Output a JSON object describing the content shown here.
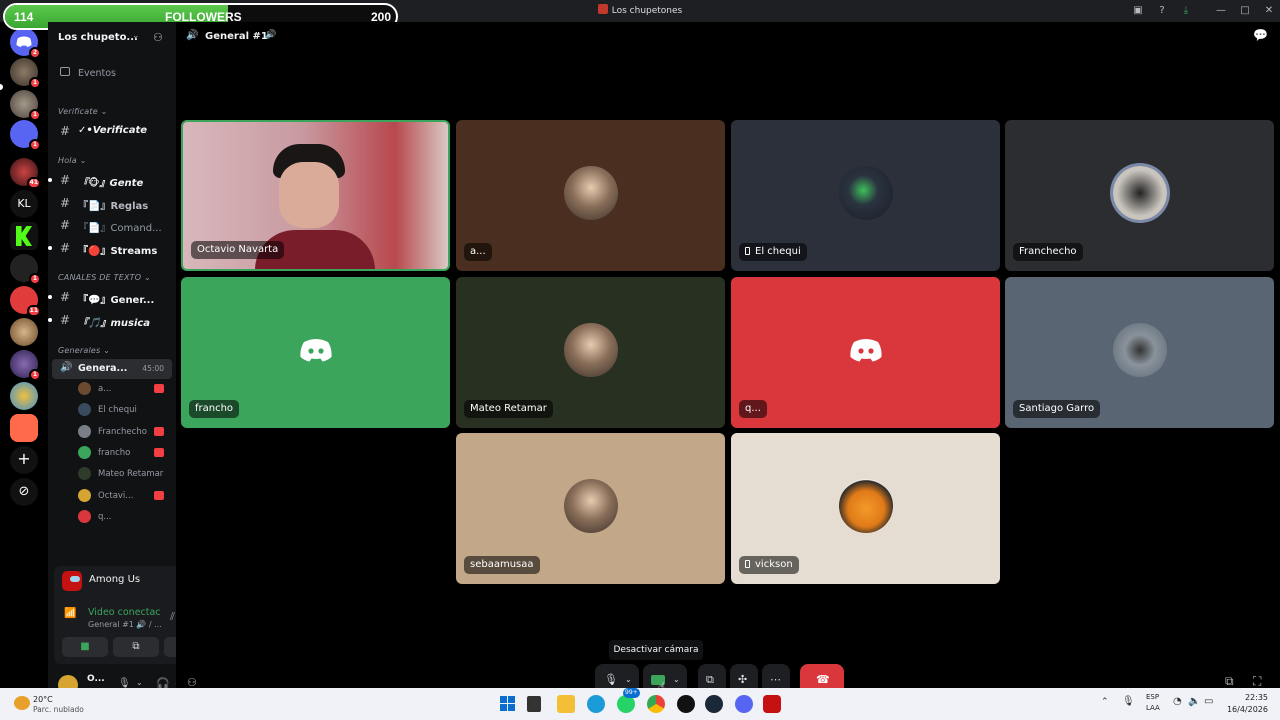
{
  "window": {
    "title": "Los chupetones"
  },
  "followers": {
    "current": "114",
    "label": "FOLLOWERS",
    "goal": "200",
    "progress_fraction": 0.57
  },
  "server": {
    "name": "Los chupeto...",
    "events_label": "Eventos"
  },
  "rail_badges": [
    "2",
    "1",
    "1",
    "1",
    "41",
    "1",
    "1",
    "11",
    "1"
  ],
  "rail_text_icon": "KL",
  "channels": {
    "cat_verificate": "Verificate",
    "ch_verificate": "✓•Verificate",
    "cat_hola": "Hola",
    "ch_gente": "『🐵』Gente",
    "ch_reglas": "『📄』Reglas",
    "ch_comandos": "『📄』Comand...",
    "ch_streams": "『🔴』Streams",
    "cat_texto": "CANALES DE TEXTO",
    "ch_general_text": "『💬』Gener...",
    "ch_musica": "『🎵』musica",
    "cat_generales": "Generales",
    "ch_general_voice": "Genera...",
    "voice_timer": "45:00"
  },
  "voice_users": [
    {
      "name": "a...",
      "color": "#6b4a2f",
      "live": true
    },
    {
      "name": "El chequi",
      "color": "#3a4a5e",
      "live": false
    },
    {
      "name": "Franchecho",
      "color": "#7a7e88",
      "live": true
    },
    {
      "name": "francho",
      "color": "#3ba55c",
      "live": true
    },
    {
      "name": "Mateo Retamar",
      "color": "#2f3b2a",
      "live": false
    },
    {
      "name": "Octavi...",
      "color": "#d6a531",
      "live": true
    },
    {
      "name": "q...",
      "color": "#da373c",
      "live": false
    }
  ],
  "activity": {
    "game": "Among Us"
  },
  "voice_panel": {
    "status": "Video conectac",
    "channel": "General #1 🔊 / ..."
  },
  "user_panel": {
    "name": "O..."
  },
  "stage": {
    "channel_title": "General #1"
  },
  "tiles": [
    {
      "name": "Octavio Navarta",
      "kind": "video",
      "bg": "#c9a3a8",
      "mobile": false
    },
    {
      "name": "a...",
      "kind": "avatar",
      "bg": "#4a2f21",
      "mobile": false
    },
    {
      "name": "El chequi",
      "kind": "avatar",
      "bg": "#2b303a",
      "mobile": true
    },
    {
      "name": "Franchecho",
      "kind": "avatar",
      "bg": "#2b2d31",
      "mobile": false
    },
    {
      "name": "francho",
      "kind": "logo",
      "bg": "#3ba55c",
      "mobile": false
    },
    {
      "name": "Mateo Retamar",
      "kind": "avatar",
      "bg": "#283022",
      "mobile": false
    },
    {
      "name": "q...",
      "kind": "logo",
      "bg": "#da373c",
      "mobile": false
    },
    {
      "name": "Santiago Garro",
      "kind": "avatar",
      "bg": "#5a6573",
      "mobile": false
    },
    {
      "name": "sebaamusaa",
      "kind": "avatar",
      "bg": "#c2a888",
      "mobile": false
    },
    {
      "name": "vickson",
      "kind": "avatar",
      "bg": "#e5ddd1",
      "mobile": true
    }
  ],
  "controls": {
    "tooltip": "Desactivar cámara"
  },
  "taskbar": {
    "temperature": "20°C",
    "weather": "Parc. nublado",
    "lang_top": "ESP",
    "lang_bottom": "LAA",
    "time": "22:35",
    "date": "16/4/2026",
    "whatsapp_badge": "99+"
  },
  "colors": {
    "accent_green": "#3ba55c",
    "danger_red": "#da373c",
    "blurple": "#5865f2"
  }
}
